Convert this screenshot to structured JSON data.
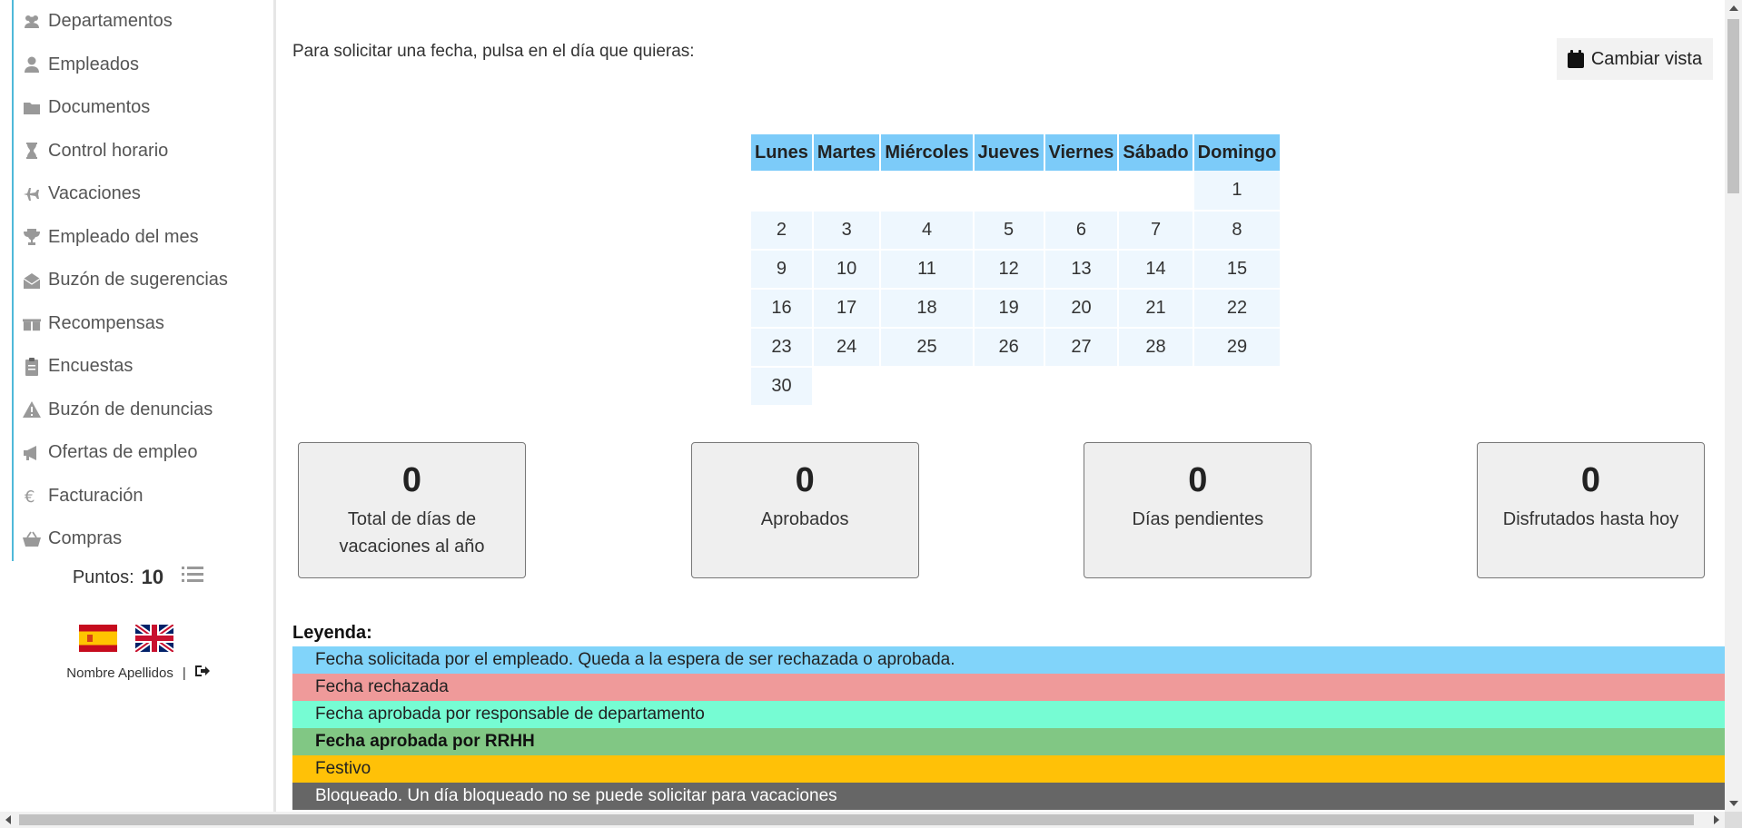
{
  "sidebar": {
    "items": [
      {
        "label": "Departamentos",
        "icon": "users-icon"
      },
      {
        "label": "Empleados",
        "icon": "user-icon"
      },
      {
        "label": "Documentos",
        "icon": "folder-icon"
      },
      {
        "label": "Control horario",
        "icon": "hourglass-icon"
      },
      {
        "label": "Vacaciones",
        "icon": "plane-icon"
      },
      {
        "label": "Empleado del mes",
        "icon": "trophy-icon"
      },
      {
        "label": "Buzón de sugerencias",
        "icon": "envelope-open-icon"
      },
      {
        "label": "Recompensas",
        "icon": "gifts-icon"
      },
      {
        "label": "Encuestas",
        "icon": "clipboard-icon"
      },
      {
        "label": "Buzón de denuncias",
        "icon": "warning-icon"
      },
      {
        "label": "Ofertas de empleo",
        "icon": "bullhorn-icon"
      },
      {
        "label": "Facturación",
        "icon": "euro-icon"
      },
      {
        "label": "Compras",
        "icon": "basket-icon"
      }
    ],
    "points_label": "Puntos:",
    "points_value": "10",
    "user_name": "Nombre Apellidos",
    "separator": "|"
  },
  "main": {
    "instruction": "Para solicitar una fecha, pulsa en el día que quieras:",
    "change_view_label": "Cambiar vista"
  },
  "calendar": {
    "headers": [
      "Lunes",
      "Martes",
      "Miércoles",
      "Jueves",
      "Viernes",
      "Sábado",
      "Domingo"
    ],
    "weeks": [
      [
        "",
        "",
        "",
        "",
        "",
        "",
        "1"
      ],
      [
        "2",
        "3",
        "4",
        "5",
        "6",
        "7",
        "8"
      ],
      [
        "9",
        "10",
        "11",
        "12",
        "13",
        "14",
        "15"
      ],
      [
        "16",
        "17",
        "18",
        "19",
        "20",
        "21",
        "22"
      ],
      [
        "23",
        "24",
        "25",
        "26",
        "27",
        "28",
        "29"
      ],
      [
        "30",
        "",
        "",
        "",
        "",
        "",
        ""
      ]
    ]
  },
  "stats": [
    {
      "value": "0",
      "label": "Total de días de vacaciones al año"
    },
    {
      "value": "0",
      "label": "Aprobados"
    },
    {
      "value": "0",
      "label": "Días pendientes"
    },
    {
      "value": "0",
      "label": "Disfrutados hasta hoy"
    }
  ],
  "legend": {
    "title": "Leyenda:",
    "items": [
      {
        "text": "Fecha solicitada por el empleado. Queda a la espera de ser rechazada o aprobada.",
        "color": "#81d4fa",
        "text_color": "#222222",
        "bold": false
      },
      {
        "text": "Fecha rechazada",
        "color": "#ef9a9a",
        "text_color": "#222222",
        "bold": false
      },
      {
        "text": "Fecha aprobada por responsable de departamento",
        "color": "#76fcd3",
        "text_color": "#222222",
        "bold": false
      },
      {
        "text": "Fecha aprobada por RRHH",
        "color": "#81c784",
        "text_color": "#111111",
        "bold": true
      },
      {
        "text": "Festivo",
        "color": "#ffc107",
        "text_color": "#222222",
        "bold": false
      },
      {
        "text": "Bloqueado. Un día bloqueado no se puede solicitar para vacaciones",
        "color": "#666666",
        "text_color": "#ffffff",
        "bold": false
      }
    ]
  },
  "colors": {
    "calendar_header": "#7ccbf9",
    "calendar_day": "#eef7fe",
    "sidebar_accent": "#4fb9d9"
  }
}
